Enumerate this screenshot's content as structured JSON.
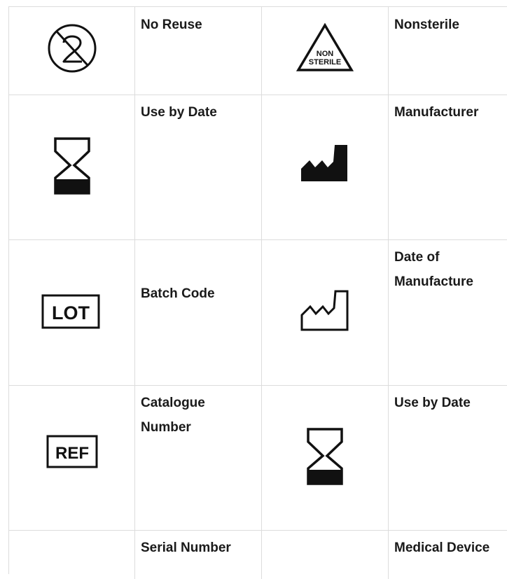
{
  "rows": [
    {
      "left": {
        "icon": "no-reuse-icon",
        "label": "No Reuse"
      },
      "right": {
        "icon": "nonsterile-icon",
        "label": "Nonsterile",
        "icon_text_1": "NON",
        "icon_text_2": "STERILE"
      }
    },
    {
      "left": {
        "icon": "hourglass-icon",
        "label": "Use by Date"
      },
      "right": {
        "icon": "factory-filled-icon",
        "label": "Manufacturer"
      }
    },
    {
      "left": {
        "icon": "lot-icon",
        "label": "Batch Code",
        "icon_text": "LOT"
      },
      "right": {
        "icon": "factory-outline-icon",
        "label": "Date of Manufacture"
      }
    },
    {
      "left": {
        "icon": "ref-icon",
        "label": "Catalogue Number",
        "icon_text": "REF"
      },
      "right": {
        "icon": "hourglass-icon",
        "label": "Use by Date"
      }
    },
    {
      "left": {
        "label": "Serial Number"
      },
      "right": {
        "label": "Medical Device"
      }
    }
  ]
}
